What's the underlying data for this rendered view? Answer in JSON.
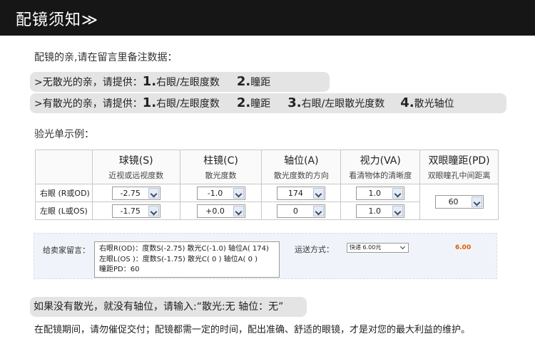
{
  "header": {
    "title": "配镜须知≫"
  },
  "intro": "配镜的亲,请在留言里备注数据：",
  "no_astig": {
    "prefix": ">无散光的亲，请提供：",
    "items": [
      {
        "num": "1.",
        "text": "右眼/左眼度数"
      },
      {
        "num": "2.",
        "text": "瞳距"
      }
    ]
  },
  "with_astig": {
    "prefix": ">有散光的亲，请提供：",
    "items": [
      {
        "num": "1.",
        "text": "右眼/左眼度数"
      },
      {
        "num": "2.",
        "text": "瞳距"
      },
      {
        "num": "3.",
        "text": "右眼/左眼散光度数"
      },
      {
        "num": "4.",
        "text": "散光轴位"
      }
    ]
  },
  "sample_title": "验光单示例：",
  "table": {
    "columns": [
      {
        "title": "球镜(S)",
        "sub": "近视或远视度数"
      },
      {
        "title": "柱镜(C)",
        "sub": "散光度数"
      },
      {
        "title": "轴位(A)",
        "sub": "散光度数的方向"
      },
      {
        "title": "视力(VA)",
        "sub": "看清物体的清晰度"
      },
      {
        "title": "双眼瞳距(PD)",
        "sub": "双眼瞳孔中间距离"
      }
    ],
    "rows": [
      {
        "label": "右眼 (R或OD)",
        "sphere": "-2.75",
        "cyl": "-1.0",
        "axis": "174",
        "va": "1.0"
      },
      {
        "label": "左眼 (L或OS)",
        "sphere": "-1.75",
        "cyl": "+0.0",
        "axis": "0",
        "va": "1.0"
      }
    ],
    "pd": "60"
  },
  "order": {
    "message_label": "给卖家留言：",
    "message_lines": [
      "右眼R(OD)：度数S(-2.75)    散光C(-1.0)    轴位A( 174)",
      "左眼L(OS )：度数S(-1.75)    散光C( 0 )      轴位A( 0 )",
      "瞳距PD：60"
    ],
    "shipping_label": "运送方式：",
    "shipping_value": "快递 6.00元",
    "price": "6.00",
    "price_color": "#e05a00"
  },
  "note": "如果没有散光，就没有轴位，请输入:“散光:无    轴位：无”",
  "footer": "在配镜期间，请勿催促交付；配镜都需一定的时间，配出准确、舒适的眼镜，才是对您的最大利益的维护。"
}
